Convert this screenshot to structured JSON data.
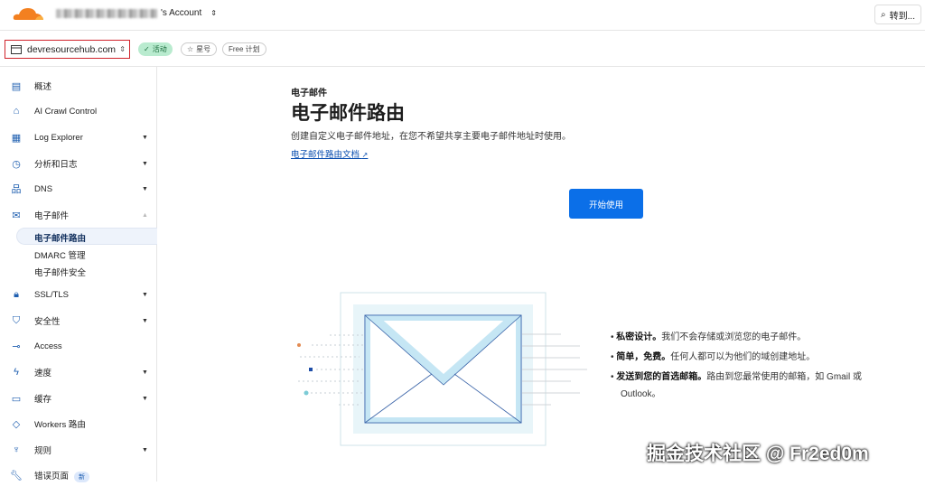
{
  "header": {
    "account_suffix": "'s Account",
    "goto_label": "转到..."
  },
  "zone": {
    "domain": "devresourcehub.com",
    "status": "活动",
    "star": "星号",
    "plan": "Free 计划"
  },
  "sidebar": {
    "items": [
      {
        "label": "概述",
        "icon": "clipboard-icon"
      },
      {
        "label": "AI Crawl Control",
        "icon": "robot-icon"
      },
      {
        "label": "Log Explorer",
        "icon": "log-file-icon"
      },
      {
        "label": "分析和日志",
        "icon": "chart-pie-icon"
      },
      {
        "label": "DNS",
        "icon": "network-icon"
      },
      {
        "label": "电子邮件",
        "icon": "envelope-icon"
      },
      {
        "label": "SSL/TLS",
        "icon": "lock-icon"
      },
      {
        "label": "安全性",
        "icon": "shield-icon"
      },
      {
        "label": "Access",
        "icon": "access-icon"
      },
      {
        "label": "速度",
        "icon": "bolt-icon"
      },
      {
        "label": "缓存",
        "icon": "cache-icon"
      },
      {
        "label": "Workers 路由",
        "icon": "workers-icon"
      },
      {
        "label": "规则",
        "icon": "rules-icon"
      },
      {
        "label": "错误页面",
        "icon": "wrench-icon",
        "badge": "新"
      }
    ],
    "email_sub": [
      "电子邮件路由",
      "DMARC 管理",
      "电子邮件安全"
    ]
  },
  "main": {
    "eyebrow": "电子邮件",
    "title": "电子邮件路由",
    "description": "创建自定义电子邮件地址，在您不希望共享主要电子邮件地址时使用。",
    "docs_link": "电子邮件路由文档",
    "start_button": "开始使用",
    "bullets": [
      {
        "bold": "私密设计。",
        "text": "我们不会存储或浏览您的电子邮件。"
      },
      {
        "bold": "简单，免费。",
        "text": "任何人都可以为他们的域创建地址。"
      },
      {
        "bold": "发送到您的首选邮箱。",
        "text": "路由到您最常使用的邮箱，如 Gmail 或 Outlook。"
      }
    ]
  },
  "watermark": "掘金技术社区 @ Fr2ed0m"
}
